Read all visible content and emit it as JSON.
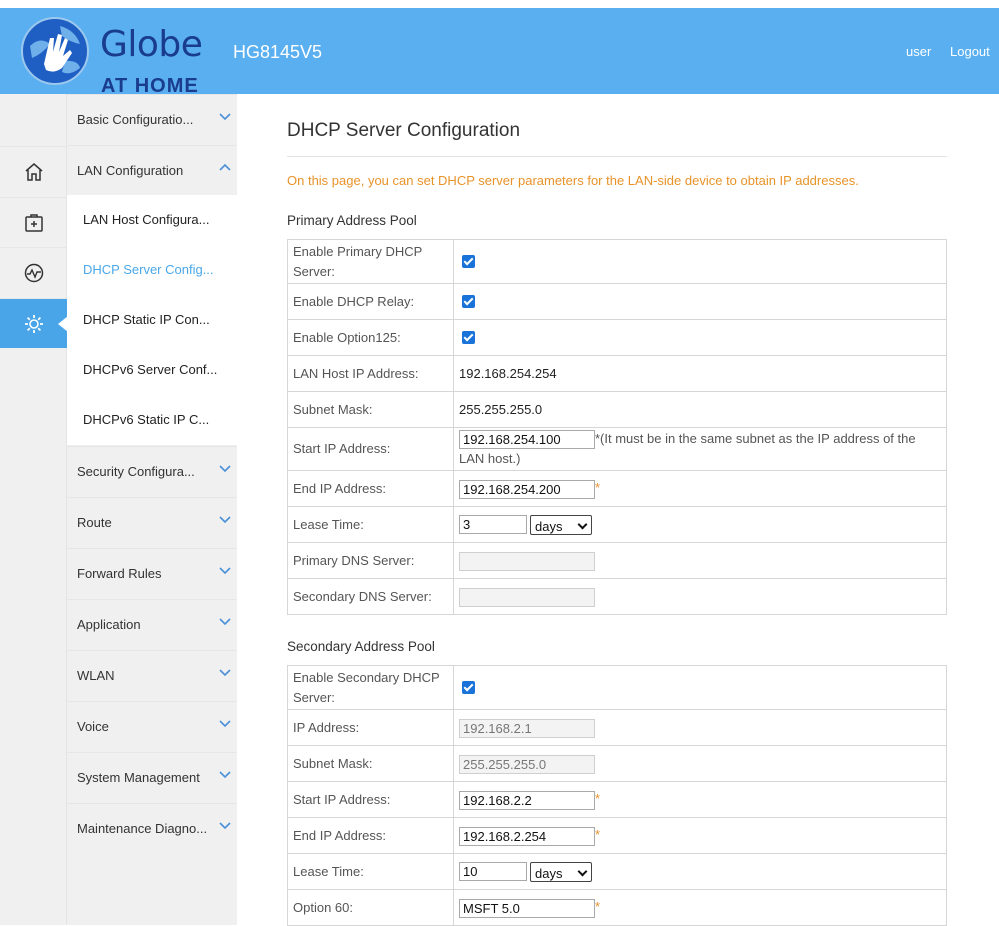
{
  "header": {
    "brand": "Globe",
    "brand_sub": "AT HOME",
    "model": "HG8145V5",
    "user_label": "user",
    "logout_label": "Logout",
    "bg_color": "#5aaff0"
  },
  "rail": {
    "icons": [
      "home-icon",
      "add-device-icon",
      "monitor-icon",
      "gear-icon"
    ],
    "active_index": 3
  },
  "menu": {
    "items": [
      {
        "label": "Basic Configuratio..."
      },
      {
        "label": "LAN Configuration"
      },
      {
        "label": "Security Configura..."
      },
      {
        "label": "Route"
      },
      {
        "label": "Forward Rules"
      },
      {
        "label": "Application"
      },
      {
        "label": "WLAN"
      },
      {
        "label": "Voice"
      },
      {
        "label": "System Management"
      },
      {
        "label": "Maintenance Diagno..."
      }
    ],
    "lan_subitems": [
      {
        "label": "LAN Host Configura..."
      },
      {
        "label": "DHCP Server Config..."
      },
      {
        "label": "DHCP Static IP Con..."
      },
      {
        "label": "DHCPv6 Server Conf..."
      },
      {
        "label": "DHCPv6 Static IP C..."
      }
    ],
    "active_color": "#4aa8e8"
  },
  "main": {
    "title": "DHCP Server Configuration",
    "description": "On this page, you can set DHCP server parameters for the LAN-side device to obtain IP addresses.",
    "primary": {
      "title": "Primary Address Pool",
      "enable_label": "Enable Primary DHCP Server:",
      "relay_label": "Enable DHCP Relay:",
      "opt125_label": "Enable Option125:",
      "lan_ip_label": "LAN Host IP Address:",
      "lan_ip_value": "192.168.254.254",
      "mask_label": "Subnet Mask:",
      "mask_value": "255.255.255.0",
      "start_label": "Start IP Address:",
      "start_value": "192.168.254.100",
      "start_note": "*(It must be in the same subnet as the IP address of the LAN host.)",
      "end_label": "End IP Address:",
      "end_value": "192.168.254.200",
      "lease_label": "Lease Time:",
      "lease_value": "3",
      "lease_unit": "days",
      "dns1_label": "Primary DNS Server:",
      "dns1_value": "",
      "dns2_label": "Secondary DNS Server:",
      "dns2_value": ""
    },
    "secondary": {
      "title": "Secondary Address Pool",
      "enable_label": "Enable Secondary DHCP Server:",
      "ip_label": "IP Address:",
      "ip_value": "192.168.2.1",
      "mask_label": "Subnet Mask:",
      "mask_value": "255.255.255.0",
      "start_label": "Start IP Address:",
      "start_value": "192.168.2.2",
      "end_label": "End IP Address:",
      "end_value": "192.168.2.254",
      "lease_label": "Lease Time:",
      "lease_value": "10",
      "lease_unit": "days",
      "opt60_label": "Option 60:",
      "opt60_value": "MSFT 5.0"
    },
    "required_mark": "*"
  }
}
